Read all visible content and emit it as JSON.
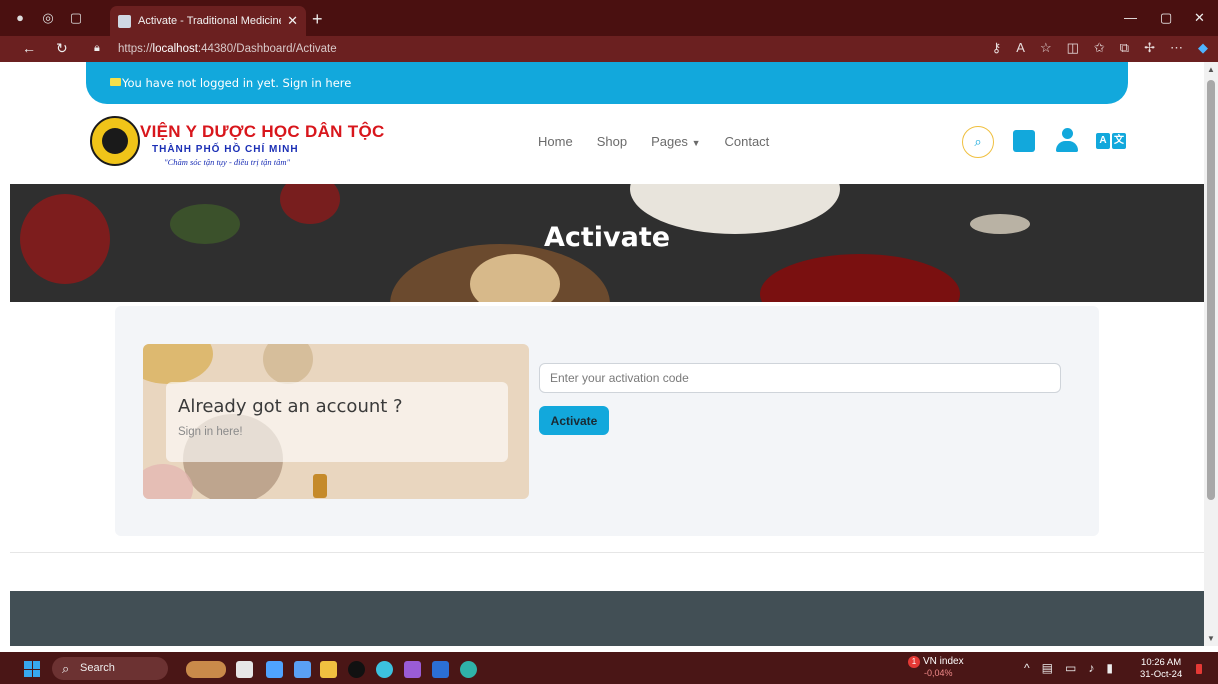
{
  "browser": {
    "tab_title": "Activate - Traditional Medicine H",
    "url_prefix": "https://",
    "url_host": "localhost",
    "url_path": ":44380/Dashboard/Activate"
  },
  "banner": {
    "text": "You have not logged in yet. Sign in here"
  },
  "logo": {
    "line1": "VIỆN Y DƯỢC HỌC DÂN TỘC",
    "line2": "THÀNH PHỐ HỒ CHÍ MINH",
    "slogan": "\"Chăm sóc tận tụy - điều trị tận tâm\""
  },
  "nav": {
    "home": "Home",
    "shop": "Shop",
    "pages": "Pages",
    "contact": "Contact"
  },
  "lang": {
    "a": "A",
    "b": "文"
  },
  "hero": {
    "title": "Activate"
  },
  "promo": {
    "title": "Already got an account ?",
    "link": "Sign in here!"
  },
  "activate_form": {
    "placeholder": "Enter your activation code",
    "button": "Activate"
  },
  "taskbar": {
    "search": "Search",
    "ticker_name": "VN index",
    "ticker_badge": "1",
    "ticker_change": "-0,04%",
    "time": "10:26 AM",
    "date": "31-Oct-24"
  },
  "colors": {
    "accent": "#12a8dc",
    "footer": "#424f55",
    "browser_frame": "#6b2020"
  }
}
